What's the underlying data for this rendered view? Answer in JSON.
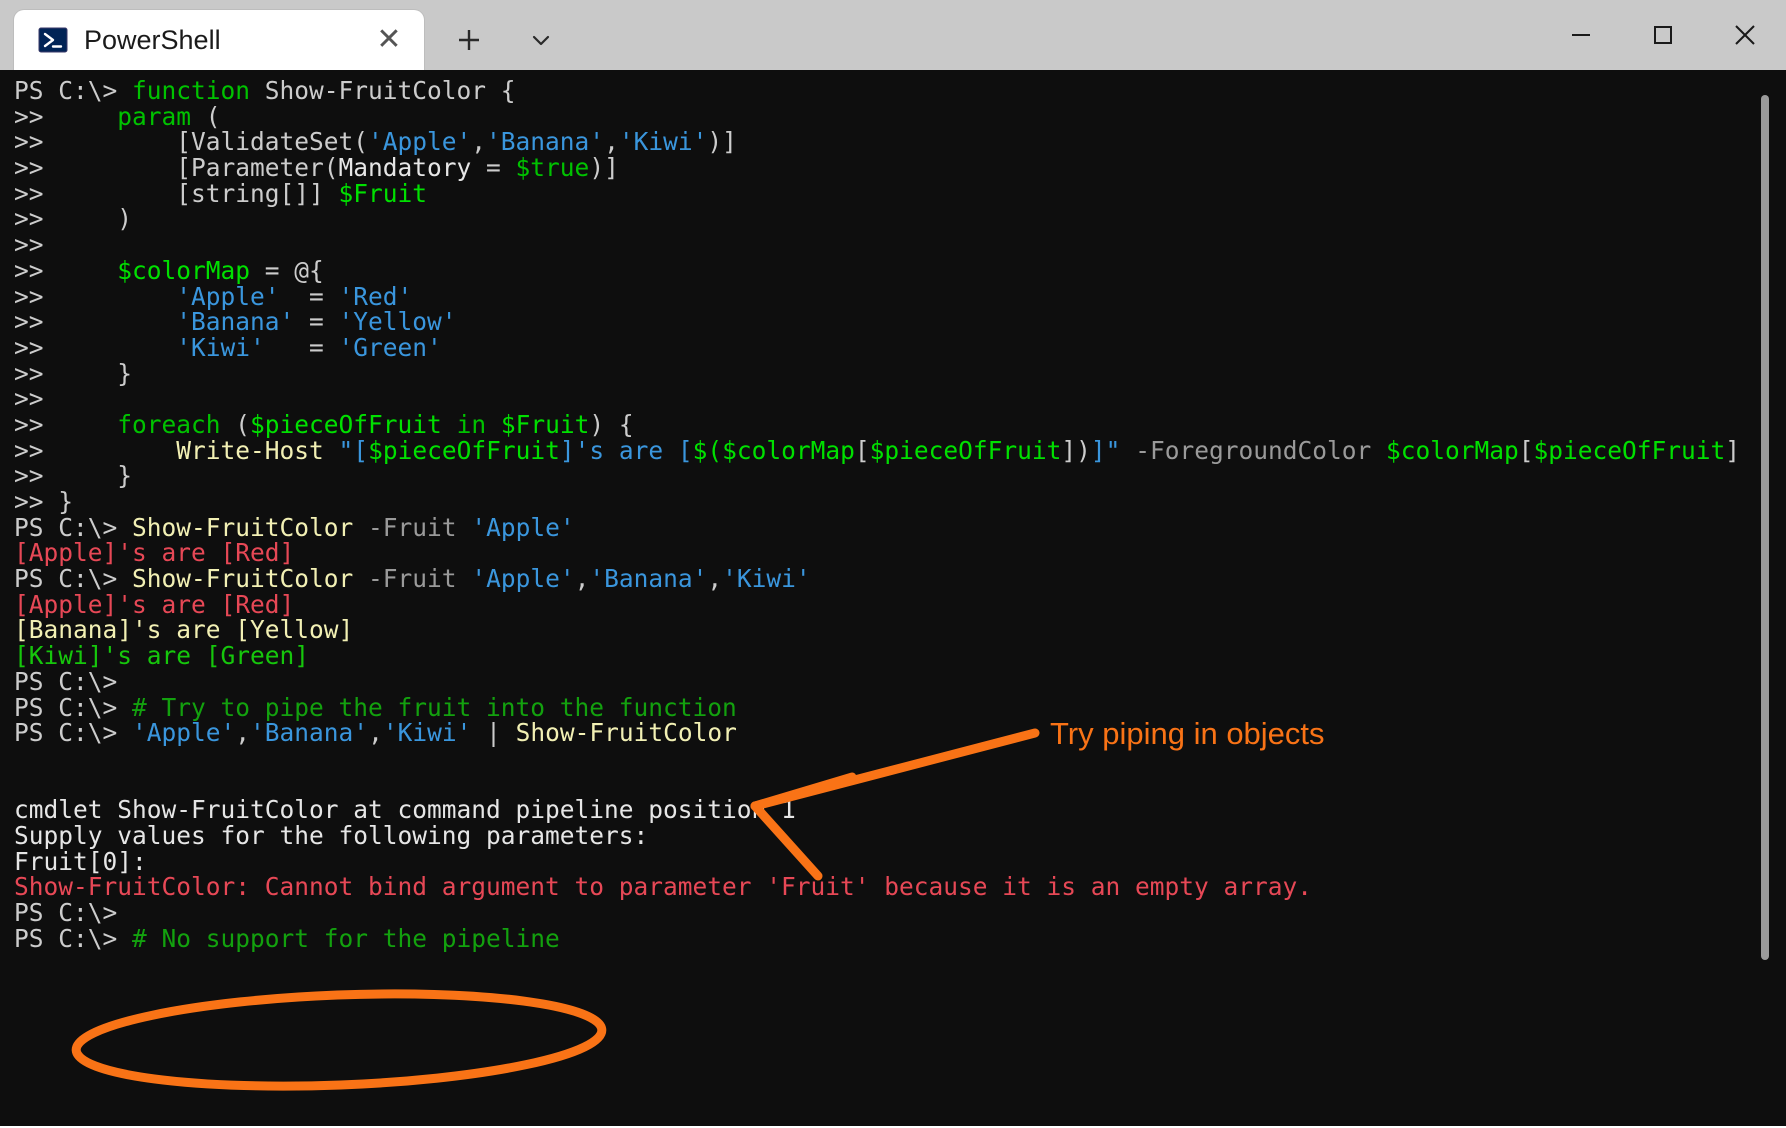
{
  "window": {
    "title": "PowerShell",
    "tab_icon": "powershell-icon",
    "close_tab_label": "✕",
    "new_tab_label": "+",
    "dropdown_label": "⌄",
    "minimize_label": "–",
    "maximize_label": "□",
    "close_label": "✕"
  },
  "colors": {
    "accent_orange": "#f97316",
    "console_bg": "#0e0e0e",
    "titlebar_bg": "#c9c9c9",
    "ps_default": "#cccccc",
    "ps_keyword": "#00c200",
    "ps_variable": "#00e000",
    "ps_string": "#3a96dd",
    "ps_command": "#f2f0b4",
    "ps_parameter": "#9a9a9a",
    "ps_comment": "#13a10e",
    "ps_error": "#e74856",
    "out_red": "#e74856",
    "out_yellow": "#f2f0b4",
    "out_green": "#16c60c"
  },
  "annotations": {
    "arrow_label": "Try piping in objects",
    "arrow_name": "orange-arrow",
    "ellipse_name": "orange-ellipse-highlight"
  },
  "console": {
    "prompt": "PS C:\\>",
    "continuation": ">>",
    "lines": [
      {
        "id": "l01",
        "segments": [
          {
            "t": "PS C:\\> ",
            "c": "c-def"
          },
          {
            "t": "function",
            "c": "c-kw"
          },
          {
            "t": " Show-FruitColor {",
            "c": "c-def"
          }
        ]
      },
      {
        "id": "l02",
        "segments": [
          {
            "t": ">>     ",
            "c": "c-def"
          },
          {
            "t": "param",
            "c": "c-kw"
          },
          {
            "t": " (",
            "c": "c-def"
          }
        ]
      },
      {
        "id": "l03",
        "segments": [
          {
            "t": ">>         [ValidateSet(",
            "c": "c-def"
          },
          {
            "t": "'Apple'",
            "c": "c-str"
          },
          {
            "t": ",",
            "c": "c-def"
          },
          {
            "t": "'Banana'",
            "c": "c-str"
          },
          {
            "t": ",",
            "c": "c-def"
          },
          {
            "t": "'Kiwi'",
            "c": "c-str"
          },
          {
            "t": ")]",
            "c": "c-def"
          }
        ]
      },
      {
        "id": "l04",
        "segments": [
          {
            "t": ">>         [Parameter(",
            "c": "c-def"
          },
          {
            "t": "Mandatory",
            "c": "c-white"
          },
          {
            "t": " = ",
            "c": "c-def"
          },
          {
            "t": "$true",
            "c": "c-kw"
          },
          {
            "t": ")]",
            "c": "c-def"
          }
        ]
      },
      {
        "id": "l05",
        "segments": [
          {
            "t": ">>         [string[]] ",
            "c": "c-def"
          },
          {
            "t": "$Fruit",
            "c": "c-var"
          }
        ]
      },
      {
        "id": "l06",
        "segments": [
          {
            "t": ">>     )",
            "c": "c-def"
          }
        ]
      },
      {
        "id": "l07",
        "segments": [
          {
            "t": ">>",
            "c": "c-def"
          }
        ]
      },
      {
        "id": "l08",
        "segments": [
          {
            "t": ">>     ",
            "c": "c-def"
          },
          {
            "t": "$colorMap",
            "c": "c-var"
          },
          {
            "t": " = @{",
            "c": "c-def"
          }
        ]
      },
      {
        "id": "l09",
        "segments": [
          {
            "t": ">>         ",
            "c": "c-def"
          },
          {
            "t": "'Apple'",
            "c": "c-str"
          },
          {
            "t": "  = ",
            "c": "c-def"
          },
          {
            "t": "'Red'",
            "c": "c-str"
          }
        ]
      },
      {
        "id": "l10",
        "segments": [
          {
            "t": ">>         ",
            "c": "c-def"
          },
          {
            "t": "'Banana'",
            "c": "c-str"
          },
          {
            "t": " = ",
            "c": "c-def"
          },
          {
            "t": "'Yellow'",
            "c": "c-str"
          }
        ]
      },
      {
        "id": "l11",
        "segments": [
          {
            "t": ">>         ",
            "c": "c-def"
          },
          {
            "t": "'Kiwi'",
            "c": "c-str"
          },
          {
            "t": "   = ",
            "c": "c-def"
          },
          {
            "t": "'Green'",
            "c": "c-str"
          }
        ]
      },
      {
        "id": "l12",
        "segments": [
          {
            "t": ">>     }",
            "c": "c-def"
          }
        ]
      },
      {
        "id": "l13",
        "segments": [
          {
            "t": ">>",
            "c": "c-def"
          }
        ]
      },
      {
        "id": "l14",
        "segments": [
          {
            "t": ">>     ",
            "c": "c-def"
          },
          {
            "t": "foreach",
            "c": "c-kw"
          },
          {
            "t": " (",
            "c": "c-def"
          },
          {
            "t": "$pieceOfFruit",
            "c": "c-var"
          },
          {
            "t": " ",
            "c": "c-def"
          },
          {
            "t": "in",
            "c": "c-kw"
          },
          {
            "t": " ",
            "c": "c-def"
          },
          {
            "t": "$Fruit",
            "c": "c-var"
          },
          {
            "t": ") {",
            "c": "c-def"
          }
        ]
      },
      {
        "id": "l15",
        "segments": [
          {
            "t": ">>         ",
            "c": "c-def"
          },
          {
            "t": "Write-Host",
            "c": "c-cmd"
          },
          {
            "t": " ",
            "c": "c-def"
          },
          {
            "t": "\"[",
            "c": "c-str"
          },
          {
            "t": "$pieceOfFruit",
            "c": "c-var"
          },
          {
            "t": "]'s are [",
            "c": "c-str"
          },
          {
            "t": "$(",
            "c": "c-var"
          },
          {
            "t": "$colorMap",
            "c": "c-var"
          },
          {
            "t": "[",
            "c": "c-def"
          },
          {
            "t": "$pieceOfFruit",
            "c": "c-var"
          },
          {
            "t": "])",
            "c": "c-def"
          },
          {
            "t": "]\"",
            "c": "c-str"
          },
          {
            "t": " ",
            "c": "c-def"
          },
          {
            "t": "-ForegroundColor",
            "c": "c-param"
          },
          {
            "t": " ",
            "c": "c-def"
          },
          {
            "t": "$colorMap",
            "c": "c-var"
          },
          {
            "t": "[",
            "c": "c-def"
          },
          {
            "t": "$pieceOfFruit",
            "c": "c-var"
          },
          {
            "t": "]",
            "c": "c-def"
          }
        ]
      },
      {
        "id": "l16",
        "segments": [
          {
            "t": ">>     }",
            "c": "c-def"
          }
        ]
      },
      {
        "id": "l17",
        "segments": [
          {
            "t": ">> }",
            "c": "c-def"
          }
        ]
      },
      {
        "id": "l18",
        "segments": [
          {
            "t": "PS C:\\> ",
            "c": "c-def"
          },
          {
            "t": "Show-FruitColor",
            "c": "c-cmd"
          },
          {
            "t": " ",
            "c": "c-def"
          },
          {
            "t": "-Fruit",
            "c": "c-param"
          },
          {
            "t": " ",
            "c": "c-def"
          },
          {
            "t": "'Apple'",
            "c": "c-str"
          }
        ]
      },
      {
        "id": "l19",
        "segments": [
          {
            "t": "[Apple]'s are [Red]",
            "c": "c-red"
          }
        ]
      },
      {
        "id": "l20",
        "segments": [
          {
            "t": "PS C:\\> ",
            "c": "c-def"
          },
          {
            "t": "Show-FruitColor",
            "c": "c-cmd"
          },
          {
            "t": " ",
            "c": "c-def"
          },
          {
            "t": "-Fruit",
            "c": "c-param"
          },
          {
            "t": " ",
            "c": "c-def"
          },
          {
            "t": "'Apple'",
            "c": "c-str"
          },
          {
            "t": ",",
            "c": "c-def"
          },
          {
            "t": "'Banana'",
            "c": "c-str"
          },
          {
            "t": ",",
            "c": "c-def"
          },
          {
            "t": "'Kiwi'",
            "c": "c-str"
          }
        ]
      },
      {
        "id": "l21",
        "segments": [
          {
            "t": "[Apple]'s are [Red]",
            "c": "c-red"
          }
        ]
      },
      {
        "id": "l22",
        "segments": [
          {
            "t": "[Banana]'s are [Yellow]",
            "c": "c-yellow"
          }
        ]
      },
      {
        "id": "l23",
        "segments": [
          {
            "t": "[Kiwi]'s are [Green]",
            "c": "c-green"
          }
        ]
      },
      {
        "id": "l24",
        "segments": [
          {
            "t": "PS C:\\>",
            "c": "c-def"
          }
        ]
      },
      {
        "id": "l25",
        "segments": [
          {
            "t": "PS C:\\> ",
            "c": "c-def"
          },
          {
            "t": "# Try to pipe the fruit into the function",
            "c": "c-cmt"
          }
        ]
      },
      {
        "id": "l26",
        "segments": [
          {
            "t": "PS C:\\> ",
            "c": "c-def"
          },
          {
            "t": "'Apple'",
            "c": "c-str"
          },
          {
            "t": ",",
            "c": "c-def"
          },
          {
            "t": "'Banana'",
            "c": "c-str"
          },
          {
            "t": ",",
            "c": "c-def"
          },
          {
            "t": "'Kiwi'",
            "c": "c-str"
          },
          {
            "t": " | ",
            "c": "c-def"
          },
          {
            "t": "Show-FruitColor",
            "c": "c-cmd"
          }
        ]
      },
      {
        "id": "l27",
        "segments": [
          {
            "t": "",
            "c": "c-def"
          }
        ]
      },
      {
        "id": "l28",
        "segments": [
          {
            "t": "",
            "c": "c-def"
          }
        ]
      },
      {
        "id": "l29",
        "segments": [
          {
            "t": "cmdlet Show-FruitColor at command pipeline position 1",
            "c": "c-white"
          }
        ]
      },
      {
        "id": "l30",
        "segments": [
          {
            "t": "Supply values for the following parameters:",
            "c": "c-white"
          }
        ]
      },
      {
        "id": "l31",
        "segments": [
          {
            "t": "Fruit[0]:",
            "c": "c-white"
          }
        ]
      },
      {
        "id": "l32",
        "segments": [
          {
            "t": "Show-FruitColor: Cannot bind argument to parameter 'Fruit' because it is an empty array.",
            "c": "c-err"
          }
        ]
      },
      {
        "id": "l33",
        "segments": [
          {
            "t": "PS C:\\>",
            "c": "c-def"
          }
        ]
      },
      {
        "id": "l34",
        "segments": [
          {
            "t": "PS C:\\> ",
            "c": "c-def"
          },
          {
            "t": "# No support for the pipeline",
            "c": "c-cmt"
          }
        ]
      }
    ]
  }
}
